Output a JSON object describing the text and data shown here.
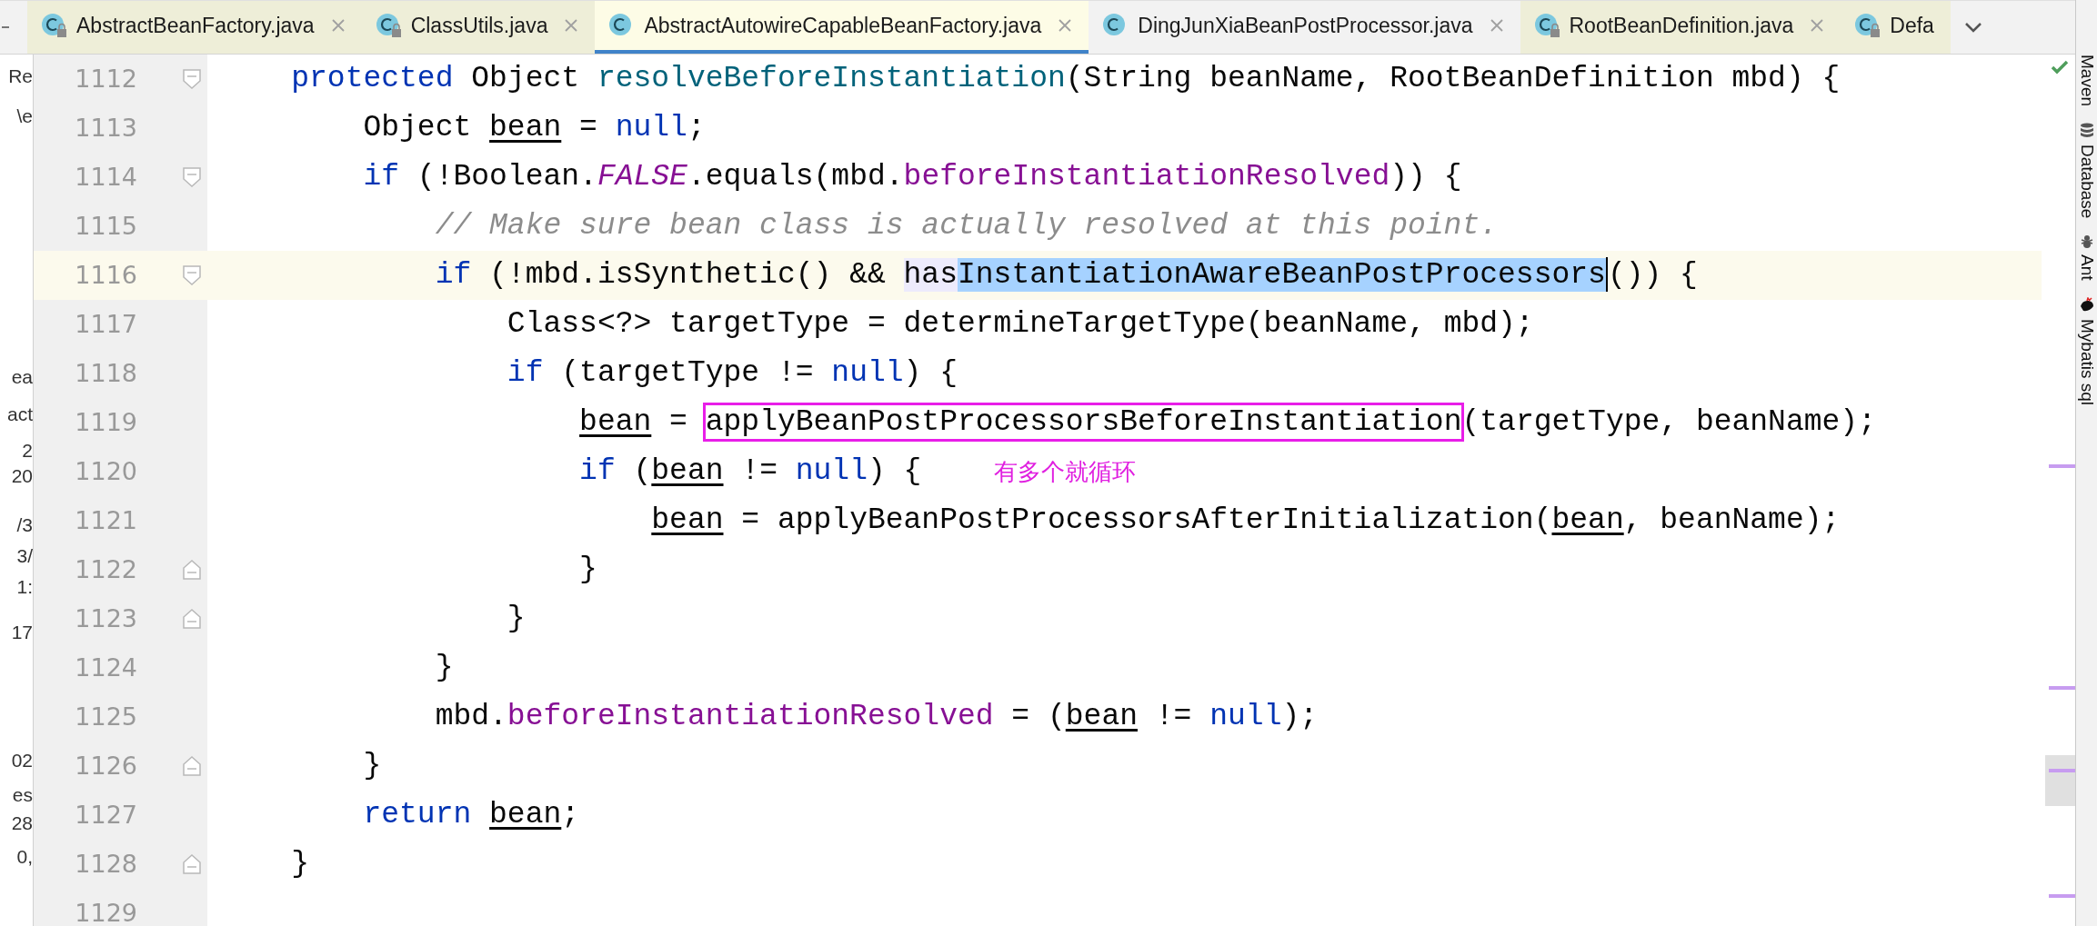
{
  "tabs": [
    {
      "label": "AbstractBeanFactory.java",
      "selected": false,
      "locked": true,
      "closable": true
    },
    {
      "label": "ClassUtils.java",
      "selected": false,
      "locked": true,
      "closable": true
    },
    {
      "label": "AbstractAutowireCapableBeanFactory.java",
      "selected": true,
      "locked": false,
      "closable": true
    },
    {
      "label": "DingJunXiaBeanPostProcessor.java",
      "selected": false,
      "locked": false,
      "closable": true
    },
    {
      "label": "RootBeanDefinition.java",
      "selected": false,
      "locked": true,
      "closable": true
    },
    {
      "label": "Defa",
      "selected": false,
      "locked": true,
      "closable": false
    }
  ],
  "left_panel_fragments": [
    "Re",
    "\\e",
    "ea",
    "act",
    "2",
    "20",
    "/3",
    "3/",
    "1:",
    "17",
    "02",
    "es",
    "28",
    "0,"
  ],
  "editor": {
    "lines": [
      {
        "number": "1112",
        "current": false,
        "fold_start": true,
        "fold_end": false,
        "caret": false,
        "tokens": [
          {
            "t": "    protected",
            "kind": "keyword"
          },
          {
            "t": " Object ",
            "kind": "plain"
          },
          {
            "t": "resolveBeforeInstantiation",
            "kind": "decl"
          },
          {
            "t": "(String beanName, RootBeanDefinition mbd) {",
            "kind": "plain"
          }
        ]
      },
      {
        "number": "1113",
        "current": false,
        "fold_start": false,
        "fold_end": false,
        "caret": false,
        "tokens": [
          {
            "t": "        Object ",
            "kind": "plain"
          },
          {
            "t": "bean",
            "kind": "var"
          },
          {
            "t": " = ",
            "kind": "plain"
          },
          {
            "t": "null",
            "kind": "keyword"
          },
          {
            "t": ";",
            "kind": "plain"
          }
        ]
      },
      {
        "number": "1114",
        "current": false,
        "fold_start": true,
        "fold_end": false,
        "caret": false,
        "tokens": [
          {
            "t": "        if",
            "kind": "keyword"
          },
          {
            "t": " (!Boolean.",
            "kind": "plain"
          },
          {
            "t": "FALSE",
            "kind": "constant"
          },
          {
            "t": ".equals(mbd.",
            "kind": "plain"
          },
          {
            "t": "beforeInstantiationResolved",
            "kind": "field"
          },
          {
            "t": ")) {",
            "kind": "plain"
          }
        ]
      },
      {
        "number": "1115",
        "current": false,
        "fold_start": false,
        "fold_end": false,
        "caret": false,
        "tokens": [
          {
            "t": "            // Make sure bean class is actually resolved at this point.",
            "kind": "comment"
          }
        ]
      },
      {
        "number": "1116",
        "current": true,
        "fold_start": true,
        "fold_end": false,
        "caret": true,
        "tokens": [
          {
            "t": "            if",
            "kind": "keyword"
          },
          {
            "t": " (!mbd.isSynthetic() && ",
            "kind": "plain"
          },
          {
            "t": "has",
            "kind": "match"
          },
          {
            "t": "InstantiationAwareBeanPostProcessors",
            "kind": "selection"
          },
          {
            "t": "()) {",
            "kind": "plain"
          }
        ]
      },
      {
        "number": "1117",
        "current": false,
        "fold_start": false,
        "fold_end": false,
        "caret": false,
        "tokens": [
          {
            "t": "                Class<?> targetType = determineTargetType(beanName, mbd);",
            "kind": "plain"
          }
        ]
      },
      {
        "number": "1118",
        "current": false,
        "fold_start": false,
        "fold_end": false,
        "caret": false,
        "tokens": [
          {
            "t": "                if",
            "kind": "keyword"
          },
          {
            "t": " (targetType != ",
            "kind": "plain"
          },
          {
            "t": "null",
            "kind": "keyword"
          },
          {
            "t": ") {",
            "kind": "plain"
          }
        ]
      },
      {
        "number": "1119",
        "current": false,
        "fold_start": false,
        "fold_end": false,
        "caret": false,
        "tokens": [
          {
            "t": "                    bean",
            "kind": "var"
          },
          {
            "t": " = ",
            "kind": "plain"
          },
          {
            "t": "applyBeanPostProcessorsBeforeInstantiation",
            "kind": "boxed"
          },
          {
            "t": "(targetType, beanName);",
            "kind": "plain"
          }
        ]
      },
      {
        "number": "1120",
        "current": false,
        "fold_start": false,
        "fold_end": false,
        "caret": false,
        "note": "有多个就循环",
        "tokens": [
          {
            "t": "                    if",
            "kind": "keyword"
          },
          {
            "t": " (",
            "kind": "plain"
          },
          {
            "t": "bean",
            "kind": "var"
          },
          {
            "t": " != ",
            "kind": "plain"
          },
          {
            "t": "null",
            "kind": "keyword"
          },
          {
            "t": ") {",
            "kind": "plain"
          }
        ]
      },
      {
        "number": "1121",
        "current": false,
        "fold_start": false,
        "fold_end": false,
        "caret": false,
        "tokens": [
          {
            "t": "                        bean",
            "kind": "var"
          },
          {
            "t": " = applyBeanPostProcessorsAfterInitialization(",
            "kind": "plain"
          },
          {
            "t": "bean",
            "kind": "var"
          },
          {
            "t": ", beanName);",
            "kind": "plain"
          }
        ]
      },
      {
        "number": "1122",
        "current": false,
        "fold_start": false,
        "fold_end": true,
        "caret": false,
        "tokens": [
          {
            "t": "                    }",
            "kind": "plain"
          }
        ]
      },
      {
        "number": "1123",
        "current": false,
        "fold_start": false,
        "fold_end": true,
        "caret": false,
        "tokens": [
          {
            "t": "                }",
            "kind": "plain"
          }
        ]
      },
      {
        "number": "1124",
        "current": false,
        "fold_start": false,
        "fold_end": false,
        "caret": false,
        "tokens": [
          {
            "t": "            }",
            "kind": "plain"
          }
        ]
      },
      {
        "number": "1125",
        "current": false,
        "fold_start": false,
        "fold_end": false,
        "caret": false,
        "tokens": [
          {
            "t": "            mbd.",
            "kind": "plain"
          },
          {
            "t": "beforeInstantiationResolved",
            "kind": "field"
          },
          {
            "t": " = (",
            "kind": "plain"
          },
          {
            "t": "bean",
            "kind": "var"
          },
          {
            "t": " != ",
            "kind": "plain"
          },
          {
            "t": "null",
            "kind": "keyword"
          },
          {
            "t": ");",
            "kind": "plain"
          }
        ]
      },
      {
        "number": "1126",
        "current": false,
        "fold_start": false,
        "fold_end": true,
        "caret": false,
        "tokens": [
          {
            "t": "        }",
            "kind": "plain"
          }
        ]
      },
      {
        "number": "1127",
        "current": false,
        "fold_start": false,
        "fold_end": false,
        "caret": false,
        "tokens": [
          {
            "t": "        return ",
            "kind": "keyword"
          },
          {
            "t": "bean",
            "kind": "var"
          },
          {
            "t": ";",
            "kind": "plain"
          }
        ]
      },
      {
        "number": "1128",
        "current": false,
        "fold_start": false,
        "fold_end": true,
        "caret": false,
        "tokens": [
          {
            "t": "    }",
            "kind": "plain"
          }
        ]
      },
      {
        "number": "1129",
        "current": false,
        "fold_start": false,
        "fold_end": false,
        "caret": false
      }
    ]
  },
  "tool_windows": [
    {
      "label": "Maven",
      "kind": "maven"
    },
    {
      "label": "Database",
      "kind": "database"
    },
    {
      "label": "Ant",
      "kind": "ant"
    },
    {
      "label": "Mybatis sql",
      "kind": "mybatis"
    }
  ]
}
